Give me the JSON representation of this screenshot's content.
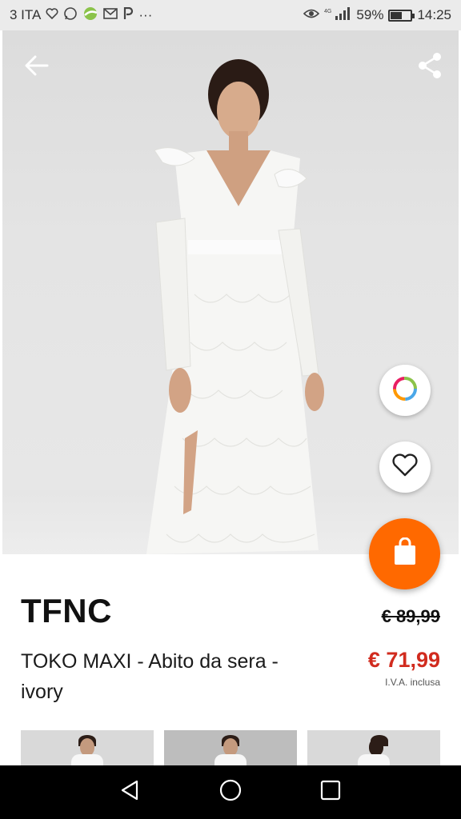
{
  "status_bar": {
    "carrier": "3 ITA",
    "battery": "59%",
    "battery_level": 0.59,
    "time": "14:25",
    "ellipsis": "···",
    "icons": [
      "heart-icon",
      "whatsapp-icon",
      "leaf-app-icon",
      "gmail-icon",
      "paypal-icon",
      "eye-icon",
      "signal-icon",
      "battery-icon"
    ]
  },
  "toolbar": {
    "back_icon": "arrow-left-icon",
    "share_icon": "share-icon"
  },
  "actions": {
    "color_icon": "color-ring-icon",
    "wishlist_icon": "heart-outline-icon",
    "cart_icon": "shopping-bag-icon",
    "cart_color": "#ff6900"
  },
  "product": {
    "brand": "TFNC",
    "name": "TOKO MAXI - Abito da sera - ivory",
    "old_price": "€ 89,99",
    "new_price": "€ 71,99",
    "vat_note": "I.V.A. inclusa",
    "price_color": "#d12b1e"
  },
  "gallery": {
    "thumbnails": [
      "thumb-1",
      "thumb-2",
      "thumb-3"
    ]
  },
  "nav": {
    "icons": [
      "back-triangle-icon",
      "home-circle-icon",
      "recents-square-icon"
    ]
  }
}
